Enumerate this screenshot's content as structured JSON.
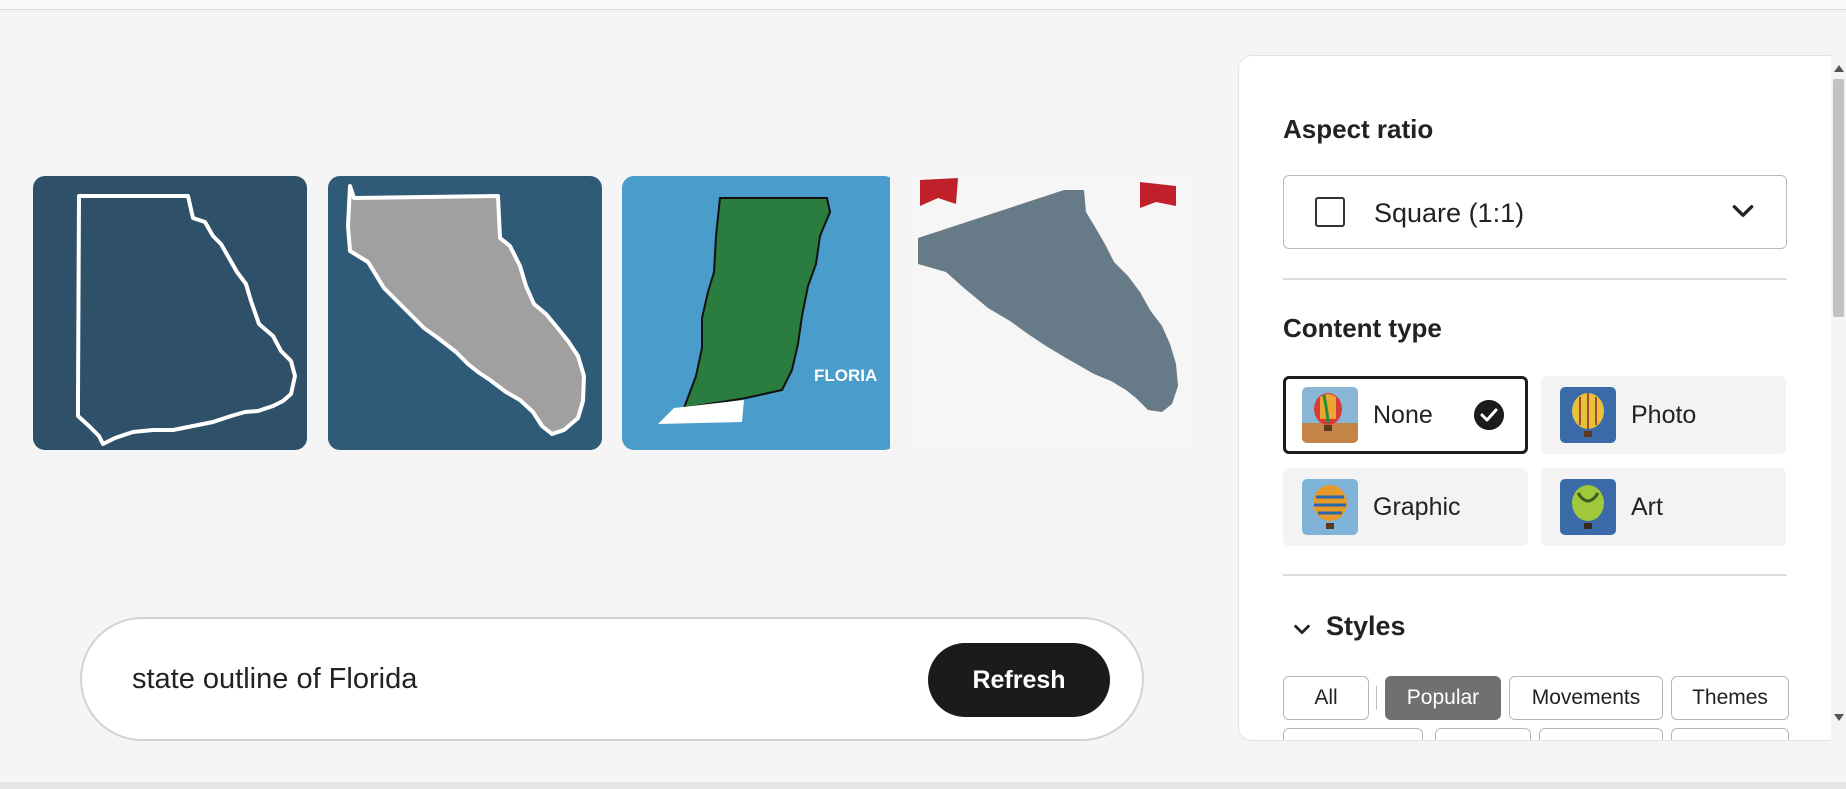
{
  "gallery": {
    "images": [
      {
        "alt": "outline on dark blue",
        "colors": {
          "bg": "#2f5069",
          "stroke": "#ffffff"
        }
      },
      {
        "alt": "gray state on blue",
        "colors": {
          "bg": "#2f5a78",
          "fill": "#a0a0a0"
        }
      },
      {
        "alt": "green state on light blue",
        "colors": {
          "bg": "#4a9ccb",
          "fill": "#2a7d3e"
        },
        "caption": "FLORIA"
      },
      {
        "alt": "slate gray state on white",
        "colors": {
          "bg": "#f6f6f6",
          "fill": "#667a87",
          "ribbon": "#c0202a"
        }
      }
    ]
  },
  "prompt": {
    "text": "state outline of Florida",
    "refresh_label": "Refresh"
  },
  "panel": {
    "aspect_ratio": {
      "heading": "Aspect ratio",
      "selected": "Square (1:1)",
      "icon": "square-icon"
    },
    "content_type": {
      "heading": "Content type",
      "options": [
        {
          "label": "None",
          "selected": true
        },
        {
          "label": "Photo",
          "selected": false
        },
        {
          "label": "Graphic",
          "selected": false
        },
        {
          "label": "Art",
          "selected": false
        }
      ]
    },
    "styles": {
      "heading": "Styles",
      "chips": [
        {
          "label": "All",
          "active": false
        },
        {
          "label": "Popular",
          "active": true
        },
        {
          "label": "Movements",
          "active": false
        },
        {
          "label": "Themes",
          "active": false
        }
      ]
    }
  },
  "colors": {
    "accent_dark": "#1b1b1b",
    "chip_active": "#707070",
    "page_bg": "#f5f5f5"
  }
}
